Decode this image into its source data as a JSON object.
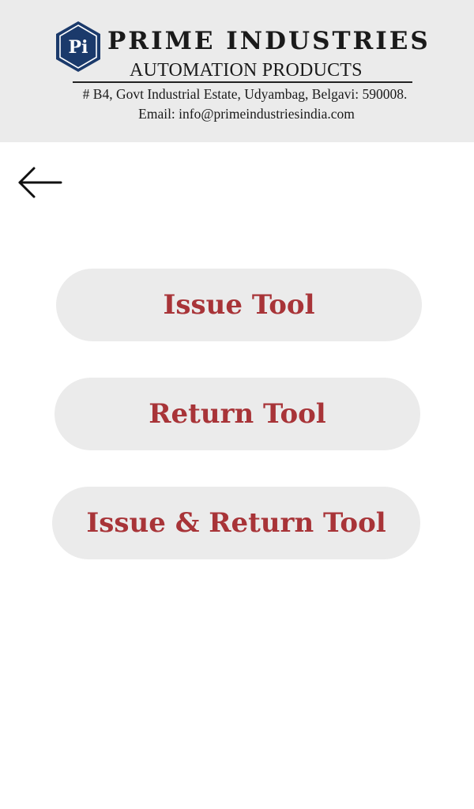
{
  "header": {
    "logo_text": "Pi",
    "company_name": "PRIME INDUSTRIES",
    "tagline": "AUTOMATION PRODUCTS",
    "address": "# B4, Govt Industrial Estate, Udyambag, Belgavi: 590008.",
    "email": "Email: info@primeindustriesindia.com"
  },
  "nav": {
    "back_icon": "arrow-left-icon"
  },
  "menu": {
    "issue_label": "Issue Tool",
    "return_label": "Return Tool",
    "issue_return_label": "Issue & Return Tool"
  },
  "colors": {
    "header_bg": "#ebebeb",
    "button_bg": "#ebebeb",
    "button_text": "#a83438",
    "logo_blue": "#1b3a6b"
  }
}
